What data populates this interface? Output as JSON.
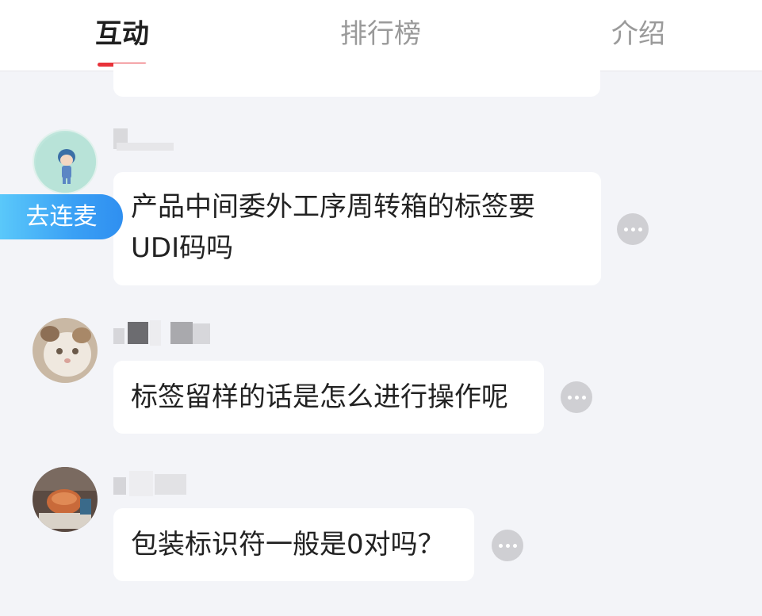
{
  "tabs": [
    {
      "label": "互动",
      "active": true
    },
    {
      "label": "排行榜",
      "active": false
    },
    {
      "label": "介绍",
      "active": false
    }
  ],
  "colors": {
    "tab_indicator": "#e8323a",
    "connect_button": "#3aa0f5",
    "background": "#f3f4f8"
  },
  "connect_button": {
    "label": "去连麦"
  },
  "messages": [
    {
      "text": "产品中间委外工序周转箱的标签要UDI码吗",
      "avatar_icon": "cartoon-avatar-icon"
    },
    {
      "text": "标签留样的话是怎么进行操作呢",
      "avatar_icon": "cat-avatar-icon"
    },
    {
      "text": "包装标识符一般是0对吗？",
      "avatar_icon": "photo-avatar-icon"
    }
  ]
}
